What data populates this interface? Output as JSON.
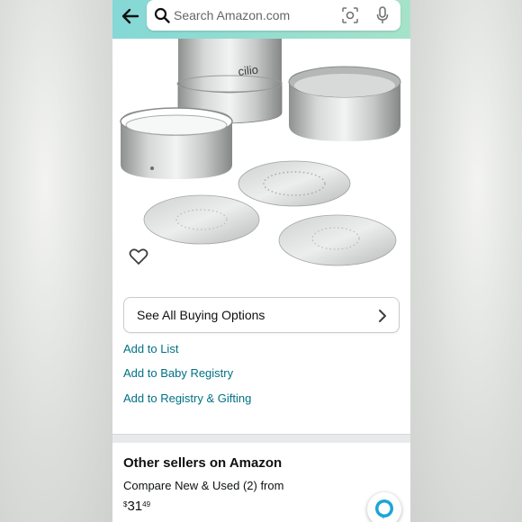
{
  "colors": {
    "topbar_gradient_start": "#84d8d6",
    "topbar_gradient_end": "#a6e2c9",
    "link": "#007185",
    "text": "#0f1111",
    "alexa": "#1ba6d6"
  },
  "search": {
    "placeholder": "Search Amazon.com",
    "icons": [
      "back-arrow-icon",
      "search-icon",
      "camera-icon",
      "mic-icon"
    ]
  },
  "product": {
    "brand_mark": "cilio",
    "icon": "heart-icon"
  },
  "buying_options": {
    "label": "See All Buying Options",
    "icon": "chevron-right-icon"
  },
  "links": {
    "add_to_list": "Add to List",
    "add_to_baby_registry": "Add to Baby Registry",
    "add_to_registry_gifting": "Add to Registry & Gifting"
  },
  "other_sellers": {
    "title": "Other sellers on Amazon",
    "compare": "Compare New & Used (2) from",
    "price_symbol": "$",
    "price_whole": "31",
    "price_fraction": "49"
  },
  "assistant": {
    "icon": "alexa-icon"
  }
}
